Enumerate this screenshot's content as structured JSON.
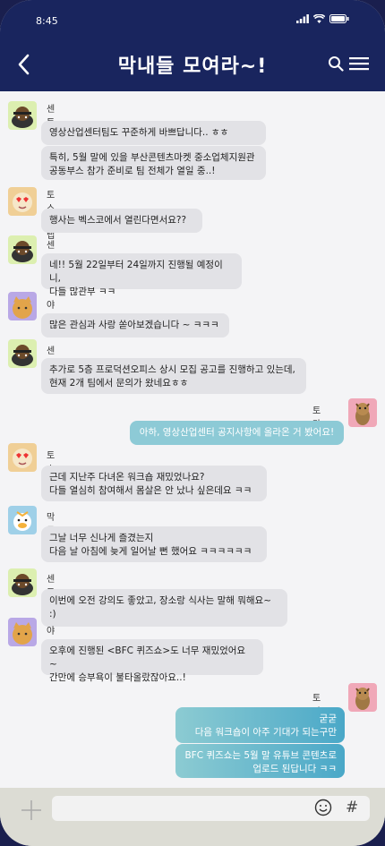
{
  "status": {
    "time": "8:45"
  },
  "header": {
    "title": "막내들 모여라~!"
  },
  "messages": [
    {
      "sender": "센토링",
      "avatar": "sentoring",
      "bubbles": [
        "영상산업센터팀도 꾸준하게 바쁘답니다.. ㅎㅎ",
        "특히, 5월 말에 있을 부산콘텐츠마켓 중소업체지원관\n공동부스 참가 준비로 팀 전체가 열일 중..!"
      ]
    },
    {
      "sender": "토스트랩",
      "avatar": "tostlab",
      "bubbles": [
        "행사는 벡스코에서 열린다면서요??"
      ]
    },
    {
      "sender": "센토링",
      "avatar": "sentoring",
      "bubbles": [
        "네!! 5월 22일부터 24일까지 진행될 예정이니,\n다들 많관부 ㅋㅋ"
      ]
    },
    {
      "sender": "야옹이",
      "avatar": "yaongi",
      "bubbles": [
        "많은 관심과 사랑 쏟아보겠습니다 ~ ㅋㅋㅋ"
      ]
    },
    {
      "sender": "센토링",
      "avatar": "sentoring",
      "bubbles": [
        "추가로 5층 프로덕션오피스 상시 모집 공고를 진행하고 있는데,\n현재 2개 팀에서 문의가 왔네요ㅎㅎ"
      ]
    },
    {
      "sender": "토마토",
      "avatar": "tomato",
      "me": true,
      "bubbles": [
        "아하, 영상산업센터 공지사항에 올라온 거 봤어요!"
      ]
    },
    {
      "sender": "토스트랩",
      "avatar": "tostlab",
      "bubbles": [
        "근데 지난주 다녀온 워크숍 재밌었나요?\n다들 열심히 참여해서 몸살은 안 났나 싶은데요 ㅋㅋ"
      ]
    },
    {
      "sender": "막두",
      "avatar": "makdu",
      "bubbles": [
        "그날 너무 신나게 즐겼는지\n다음 날 아침에 늦게 일어날 뻔 했어요 ㅋㅋㅋㅋㅋㅋ"
      ]
    },
    {
      "sender": "센토링",
      "avatar": "sentoring",
      "bubbles": [
        "이번에 오전 강의도 좋았고, 장소랑 식사는 말해 뭐해요~ :)"
      ]
    },
    {
      "sender": "야옹이",
      "avatar": "yaongi",
      "bubbles": [
        "오후에 진행된 <BFC 퀴즈쇼>도 너무 재밌었어요 ~\n간만에 승부욕이 불타올랐잖아요..!"
      ]
    },
    {
      "sender": "토마토",
      "avatar": "tomato",
      "me": true,
      "bubbles": [
        "굳굳\n다음 워크숍이 아주 기대가 되는구만",
        "BFC 퀴즈쇼는 5월 말 유튜브 콘텐츠로\n업로드 된답니다 ㅋㅋ"
      ]
    }
  ],
  "colors": {
    "header": "#19255e",
    "my_bubble": "#4aa8c8",
    "other_bubble": "#e2e2e6"
  },
  "icons": {
    "back": "chevron-left-icon",
    "search": "search-icon",
    "menu": "hamburger-icon",
    "plus": "plus-icon",
    "emoji": "smiley-icon",
    "hash": "hash-icon"
  },
  "inputbar": {
    "hash_symbol": "#"
  }
}
